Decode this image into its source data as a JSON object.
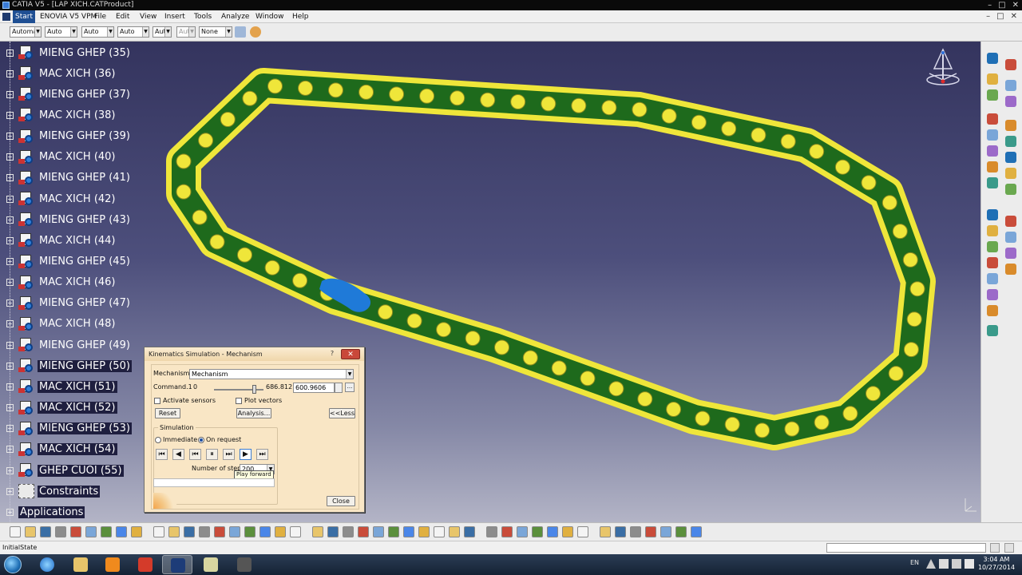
{
  "window": {
    "title": "CATIA V5 - [LAP XICH.CATProduct]",
    "minimize": "–",
    "maximize": "□",
    "close": "✕"
  },
  "menu": {
    "start": "Start",
    "items": [
      "ENOVIA V5 VPM",
      "File",
      "Edit",
      "View",
      "Insert",
      "Tools",
      "Analyze",
      "Window",
      "Help"
    ]
  },
  "properties_toolbar": {
    "combos": [
      "Automá",
      "Auto",
      "Auto",
      "Auto",
      "Aut",
      "Aut",
      "None"
    ]
  },
  "tree": {
    "items": [
      {
        "label": "MIENG GHEP (35)",
        "highlighted": false
      },
      {
        "label": "MAC XICH (36)",
        "highlighted": false
      },
      {
        "label": "MIENG GHEP (37)",
        "highlighted": false
      },
      {
        "label": "MAC XICH (38)",
        "highlighted": false
      },
      {
        "label": "MIENG GHEP (39)",
        "highlighted": false
      },
      {
        "label": "MAC XICH (40)",
        "highlighted": false
      },
      {
        "label": "MIENG GHEP (41)",
        "highlighted": false
      },
      {
        "label": "MAC XICH (42)",
        "highlighted": false
      },
      {
        "label": "MIENG GHEP (43)",
        "highlighted": false
      },
      {
        "label": "MAC XICH (44)",
        "highlighted": false
      },
      {
        "label": "MIENG GHEP (45)",
        "highlighted": false
      },
      {
        "label": "MAC XICH (46)",
        "highlighted": false
      },
      {
        "label": "MIENG GHEP (47)",
        "highlighted": false
      },
      {
        "label": "MAC XICH (48)",
        "highlighted": false
      },
      {
        "label": "MIENG GHEP (49)",
        "highlighted": false
      },
      {
        "label": "MIENG GHEP (50)",
        "highlighted": true
      },
      {
        "label": "MAC XICH (51)",
        "highlighted": true
      },
      {
        "label": "MAC XICH (52)",
        "highlighted": true
      },
      {
        "label": "MIENG GHEP (53)",
        "highlighted": true
      },
      {
        "label": "MAC XICH (54)",
        "highlighted": true
      },
      {
        "label": "GHEP CUOI (55)",
        "highlighted": true
      }
    ],
    "constraints": "Constraints",
    "applications": "Applications"
  },
  "dialog": {
    "title": "Kinematics Simulation - Mechanism",
    "help": "?",
    "close_x": "✕",
    "mechanism_label": "Mechanism:",
    "mechanism_value": "Mechanism",
    "command_label": "Command.1",
    "command_min": "0",
    "command_max": "686.812",
    "command_value": "600.9606",
    "more": "...",
    "activate_sensors": "Activate sensors",
    "plot_vectors": "Plot vectors",
    "reset": "Reset",
    "analysis": "Analysis...",
    "less": "<<Less",
    "simulation_group": "Simulation",
    "immediate": "Immediate",
    "on_request": "On request",
    "on_request_selected": true,
    "number_of_steps_label": "Number of steps",
    "number_of_steps_value": "200",
    "tooltip": "Play forward",
    "close": "Close",
    "playback": [
      "⏮",
      "◀",
      "⏮",
      "⏸",
      "⏭",
      "▶",
      "⏭"
    ]
  },
  "status": {
    "text": "InitialState"
  },
  "taskbar": {
    "language": "EN",
    "time": "3:04 AM",
    "date": "10/27/2014"
  },
  "colors": {
    "viewport_top": "#34345e",
    "viewport_bottom": "#b3b4c6",
    "chain_plate": "#efe63a",
    "chain_pin": "#1e6a1c",
    "chain_selected": "#1f7ad8",
    "dialog_bg": "#f9e6c5"
  }
}
